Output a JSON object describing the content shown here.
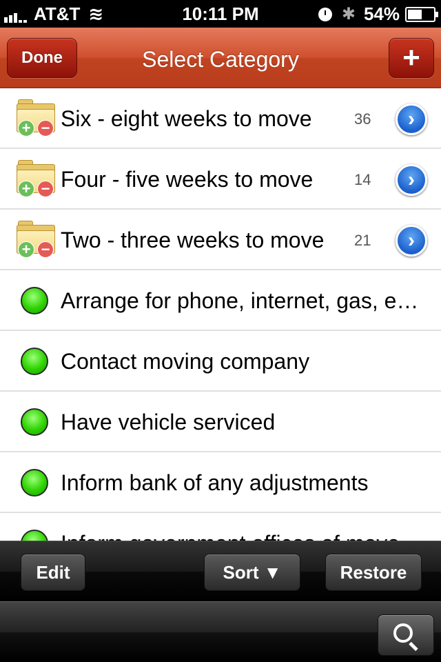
{
  "status": {
    "carrier": "AT&T",
    "time": "10:11 PM",
    "battery": "54%"
  },
  "nav": {
    "done_label": "Done",
    "title": "Select Category",
    "add_label": "+"
  },
  "list": {
    "folders": [
      {
        "label": "Six - eight weeks to move",
        "count": "36"
      },
      {
        "label": "Four - five weeks to move",
        "count": "14"
      },
      {
        "label": "Two - three weeks to move",
        "count": "21"
      }
    ],
    "items": [
      {
        "label": "Arrange for phone, internet, gas, electricity"
      },
      {
        "label": "Contact moving company"
      },
      {
        "label": "Have vehicle serviced"
      },
      {
        "label": "Inform bank of any adjustments"
      },
      {
        "label": "Inform government offices of move"
      }
    ]
  },
  "toolbar": {
    "edit_label": "Edit",
    "sort_label": "Sort ▼",
    "restore_label": "Restore"
  },
  "icons": {
    "disclosure": "chevron-right-icon",
    "folder": "folder-add-remove-icon",
    "status": "green-dot-icon",
    "search": "search-icon"
  },
  "colors": {
    "nav_red": "#c04421",
    "disclosure_blue": "#1b5fcc",
    "status_green": "#2ed300"
  }
}
